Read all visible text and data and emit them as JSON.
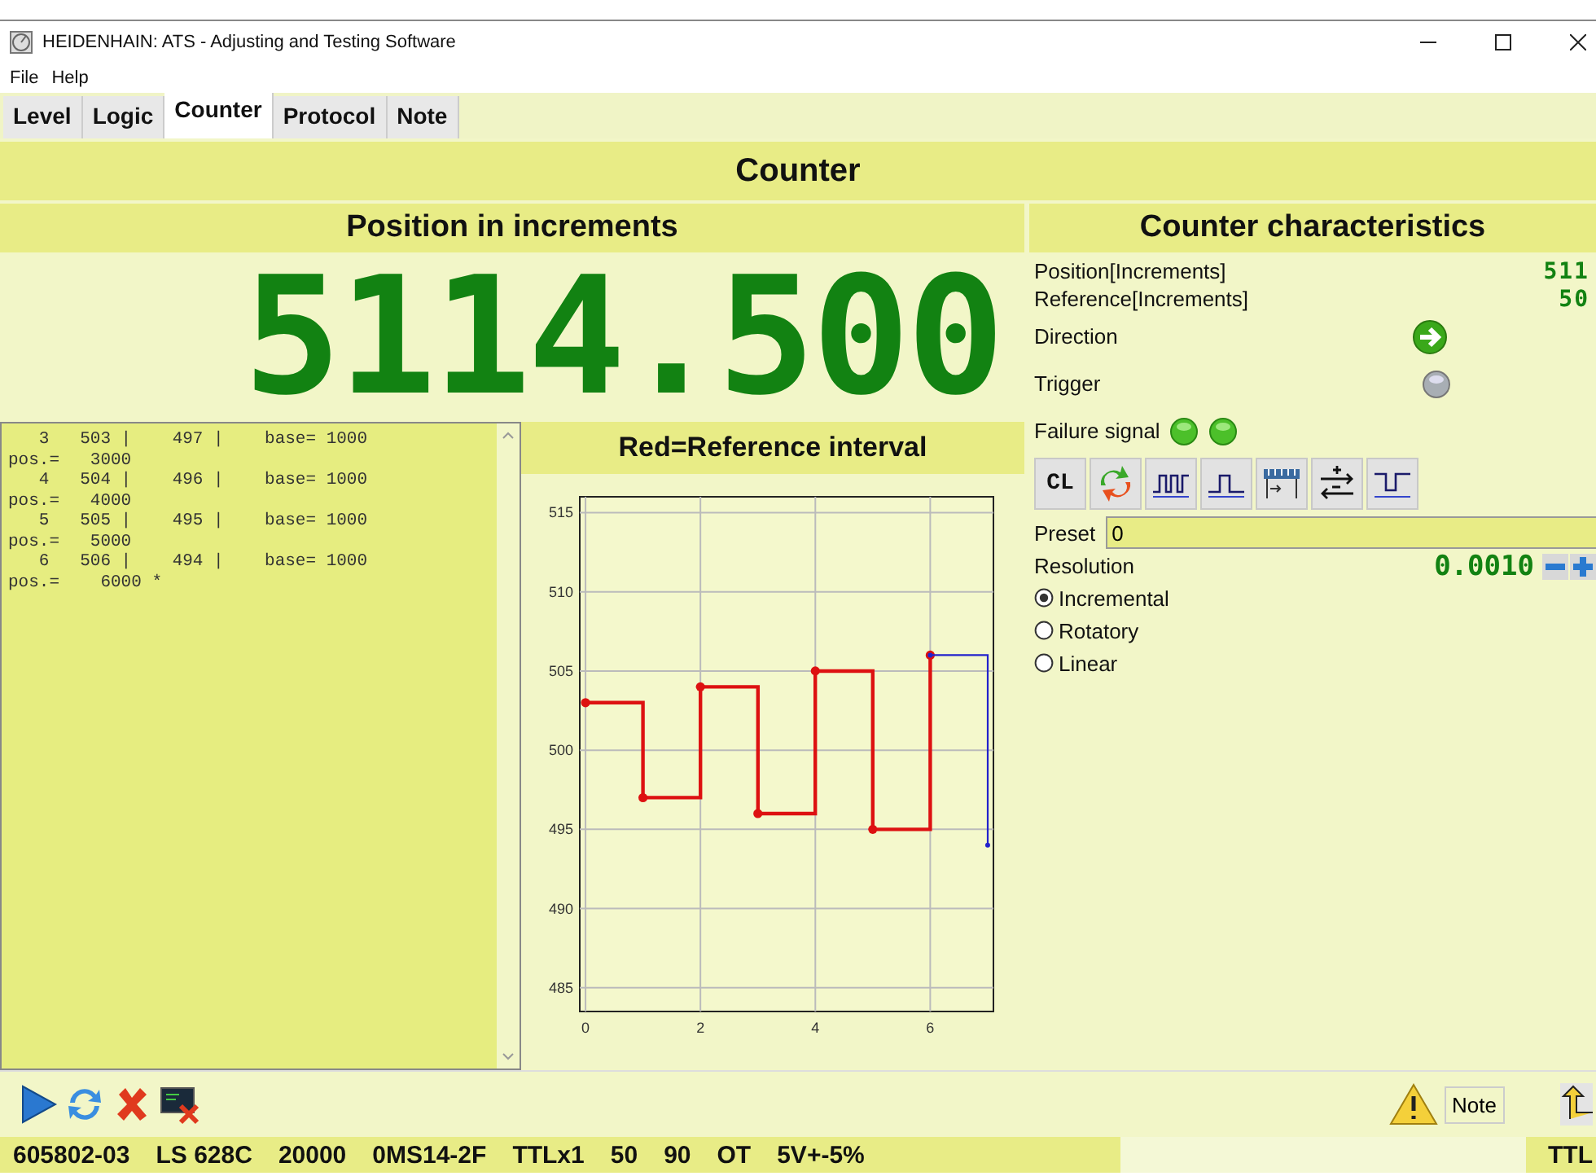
{
  "window": {
    "title": "HEIDENHAIN: ATS - Adjusting and Testing Software"
  },
  "menu": [
    "File",
    "Help"
  ],
  "tabs": [
    {
      "label": "Level",
      "selected": false
    },
    {
      "label": "Logic",
      "selected": false
    },
    {
      "label": "Counter",
      "selected": true
    },
    {
      "label": "Protocol",
      "selected": false
    },
    {
      "label": "Note",
      "selected": false
    }
  ],
  "page_title": "Counter",
  "position_panel": {
    "title": "Position in increments",
    "display": "5114.500"
  },
  "log": [
    "   3   503 |    497 |    base= 1000",
    "pos.=   3000",
    "   4   504 |    496 |    base= 1000",
    "pos.=   4000",
    "   5   505 |    495 |    base= 1000",
    "pos.=   5000",
    "   6   506 |    494 |    base= 1000",
    "pos.=    6000 *"
  ],
  "chart": {
    "chart_data": {
      "type": "line",
      "grid": true,
      "title": "Red=Reference interval",
      "x": [
        0,
        1,
        1,
        2,
        2,
        3,
        3,
        4,
        4,
        5,
        5,
        6,
        6,
        7,
        7
      ],
      "xlim": [
        -0.1,
        7.1
      ],
      "ylim": [
        483.5,
        516
      ],
      "xticks": [
        0,
        2,
        4,
        6
      ],
      "yticks": [
        485,
        490,
        495,
        500,
        505,
        510,
        515
      ],
      "series": [
        {
          "color": "#dd1111",
          "values": [
            503,
            503,
            497,
            497,
            504,
            504,
            496,
            496,
            505,
            505,
            495,
            495,
            506,
            null,
            null
          ]
        },
        {
          "color": "#2222cc",
          "values": [
            null,
            null,
            null,
            null,
            null,
            null,
            null,
            null,
            null,
            null,
            null,
            null,
            506,
            506,
            494
          ]
        }
      ]
    }
  },
  "characteristics": {
    "title": "Counter characteristics",
    "readings": [
      {
        "label": "Position[Increments]",
        "value": "511"
      },
      {
        "label": "Reference[Increments]",
        "value": "50"
      }
    ],
    "direction": {
      "label": "Direction",
      "forward": true
    },
    "trigger": {
      "label": "Trigger",
      "on": false
    },
    "failure_signal": {
      "label": "Failure signal",
      "signals": [
        {
          "on": true
        },
        {
          "on": true
        }
      ]
    },
    "tools": [
      {
        "kind": "text",
        "label": "CL"
      },
      {
        "kind": "swap"
      },
      {
        "kind": "pulses"
      },
      {
        "kind": "pulse"
      },
      {
        "kind": "scale"
      },
      {
        "kind": "plusminus"
      },
      {
        "kind": "notch"
      }
    ],
    "preset": {
      "label": "Preset",
      "value": "0"
    },
    "resolution": {
      "label": "Resolution",
      "value": "0.0010"
    },
    "modes": [
      {
        "label": "Incremental",
        "selected": true
      },
      {
        "label": "Rotatory",
        "selected": false
      },
      {
        "label": "Linear",
        "selected": false
      }
    ]
  },
  "toolbar": {
    "note_button": "Note"
  },
  "status_bar": {
    "fields": [
      "605802-03",
      "LS 628C",
      "20000",
      "0MS14-2F",
      "TTLx1",
      "50",
      "90",
      "OT",
      "5V+-5%"
    ],
    "right": "TTL"
  }
}
